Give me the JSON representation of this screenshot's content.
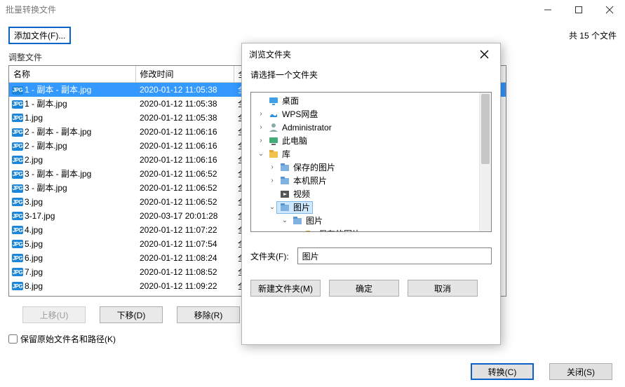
{
  "window": {
    "title": "批量转换文件"
  },
  "toolbar": {
    "add_file_label": "添加文件(F)...",
    "file_count_text": "共 15 个文件"
  },
  "group": {
    "adjust_label": "调整文件"
  },
  "table": {
    "headers": {
      "name": "名称",
      "date": "修改时间",
      "full": "全"
    },
    "rows": [
      {
        "name": "1 - 副本 - 副本.jpg",
        "date": "2020-01-12 11:05:38",
        "full": "全",
        "selected": true
      },
      {
        "name": "1 - 副本.jpg",
        "date": "2020-01-12 11:05:38",
        "full": "全"
      },
      {
        "name": "1.jpg",
        "date": "2020-01-12 11:05:38",
        "full": "全"
      },
      {
        "name": "2 - 副本 - 副本.jpg",
        "date": "2020-01-12 11:06:16",
        "full": "全"
      },
      {
        "name": "2 - 副本.jpg",
        "date": "2020-01-12 11:06:16",
        "full": "全"
      },
      {
        "name": "2.jpg",
        "date": "2020-01-12 11:06:16",
        "full": "全"
      },
      {
        "name": "3 - 副本 - 副本.jpg",
        "date": "2020-01-12 11:06:52",
        "full": "全"
      },
      {
        "name": "3 - 副本.jpg",
        "date": "2020-01-12 11:06:52",
        "full": "全"
      },
      {
        "name": "3.jpg",
        "date": "2020-01-12 11:06:52",
        "full": "全"
      },
      {
        "name": "3-17.jpg",
        "date": "2020-03-17 20:01:28",
        "full": "全"
      },
      {
        "name": "4.jpg",
        "date": "2020-01-12 11:07:22",
        "full": "全"
      },
      {
        "name": "5.jpg",
        "date": "2020-01-12 11:07:54",
        "full": "全"
      },
      {
        "name": "6.jpg",
        "date": "2020-01-12 11:08:24",
        "full": "全"
      },
      {
        "name": "7.jpg",
        "date": "2020-01-12 11:08:52",
        "full": "全"
      },
      {
        "name": "8.jpg",
        "date": "2020-01-12 11:09:22",
        "full": "全"
      }
    ]
  },
  "actions": {
    "move_up": "上移(U)",
    "move_down": "下移(D)",
    "remove": "移除(R)"
  },
  "keep": {
    "label": "保留原始文件名和路径(K)"
  },
  "footer": {
    "convert": "转换(C)",
    "close": "关闭(S)"
  },
  "browse_dialog": {
    "title": "浏览文件夹",
    "prompt": "请选择一个文件夹",
    "folder_field_label": "文件夹(F):",
    "folder_field_value": "图片",
    "new_folder": "新建文件夹(M)",
    "ok": "确定",
    "cancel": "取消",
    "tree": [
      {
        "level": 0,
        "caret": "none",
        "icon": "desktop",
        "label": "桌面"
      },
      {
        "level": 0,
        "caret": "right",
        "icon": "wps",
        "label": "WPS网盘"
      },
      {
        "level": 0,
        "caret": "right",
        "icon": "user",
        "label": "Administrator"
      },
      {
        "level": 0,
        "caret": "right",
        "icon": "pc",
        "label": "此电脑"
      },
      {
        "level": 0,
        "caret": "down",
        "icon": "lib",
        "label": "库"
      },
      {
        "level": 1,
        "caret": "right",
        "icon": "libitem",
        "label": "保存的图片"
      },
      {
        "level": 1,
        "caret": "right",
        "icon": "libitem",
        "label": "本机照片"
      },
      {
        "level": 1,
        "caret": "none",
        "icon": "video",
        "label": "视频"
      },
      {
        "level": 1,
        "caret": "down",
        "icon": "libitem",
        "label": "图片",
        "selected": true
      },
      {
        "level": 2,
        "caret": "down",
        "icon": "libitem",
        "label": "图片"
      },
      {
        "level": 3,
        "caret": "none",
        "icon": "folder",
        "label": "保存的图片",
        "half": true
      }
    ]
  }
}
